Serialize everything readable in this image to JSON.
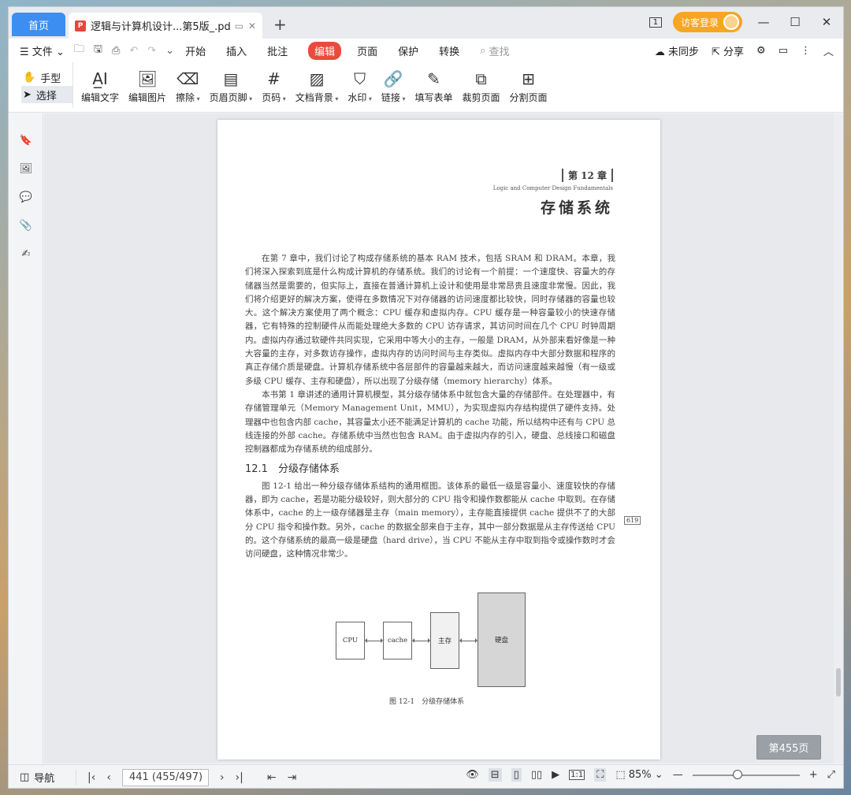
{
  "tabs": {
    "home": "首页",
    "doc_title": "逻辑与计算机设计...第5版_.pdf",
    "pdf_badge": "P"
  },
  "account": {
    "login": "访客登录",
    "page_badge": "1"
  },
  "menu": {
    "file": "文件",
    "items": [
      "开始",
      "插入",
      "批注",
      "编辑",
      "页面",
      "保护",
      "转换"
    ],
    "active": "编辑",
    "search": "查找",
    "sync": "未同步",
    "share": "分享"
  },
  "mode": {
    "hand": "手型",
    "select": "选择"
  },
  "tools": [
    {
      "label": "编辑文字",
      "icon": "text-edit-icon",
      "glyph": "A̲I"
    },
    {
      "label": "编辑图片",
      "icon": "image-edit-icon",
      "glyph": "🖼"
    },
    {
      "label": "擦除",
      "icon": "eraser-icon",
      "glyph": "⌫",
      "dropdown": true
    },
    {
      "label": "页眉页脚",
      "icon": "header-footer-icon",
      "glyph": "▤",
      "dropdown": true
    },
    {
      "label": "页码",
      "icon": "page-number-icon",
      "glyph": "#",
      "dropdown": true
    },
    {
      "label": "文档背景",
      "icon": "background-icon",
      "glyph": "▨",
      "dropdown": true
    },
    {
      "label": "水印",
      "icon": "watermark-icon",
      "glyph": "⛉",
      "dropdown": true
    },
    {
      "label": "链接",
      "icon": "link-icon",
      "glyph": "🔗",
      "dropdown": true
    },
    {
      "label": "填写表单",
      "icon": "form-icon",
      "glyph": "✎"
    },
    {
      "label": "裁剪页面",
      "icon": "crop-page-icon",
      "glyph": "⧉"
    },
    {
      "label": "分割页面",
      "icon": "split-page-icon",
      "glyph": "⊞"
    }
  ],
  "document": {
    "chapter_num": "第 12 章",
    "chapter_en": "Logic and Computer Design Fundamentals",
    "chapter_title": "存储系统",
    "para1": "在第 7 章中，我们讨论了构成存储系统的基本 RAM 技术，包括 SRAM 和 DRAM。本章，我们将深入探索到底是什么构成计算机的存储系统。我们的讨论有一个前提：一个速度快、容量大的存储器当然是需要的，但实际上，直接在普通计算机上设计和使用是非常昂贵且速度非常慢。因此，我们将介绍更好的解决方案，使得在多数情况下对存储器的访问速度都比较快，同时存储器的容量也较大。这个解决方案使用了两个概念：CPU 缓存和虚拟内存。CPU 缓存是一种容量较小的快速存储器，它有特殊的控制硬件从而能处理绝大多数的 CPU 访存请求，其访问时间在几个 CPU 时钟周期内。虚拟内存通过软硬件共同实现，它采用中等大小的主存，一般是 DRAM，从外部来看好像是一种大容量的主存，对多数访存操作，虚拟内存的访问时间与主存类似。虚拟内存中大部分数据和程序的真正存储介质是硬盘。计算机存储系统中各层部件的容量越来越大，而访问速度越来越慢（有一级或多级 CPU 缓存、主存和硬盘），所以出现了分级存储（memory hierarchy）体系。",
    "para2": "本书第 1 章讲述的通用计算机模型，其分级存储体系中就包含大量的存储部件。在处理器中，有存储管理单元（Memory Management Unit，MMU），为实现虚拟内存结构提供了硬件支持。处理器中也包含内部 cache，其容量太小还不能满足计算机的 cache 功能，所以结构中还有与 CPU 总线连接的外部 cache。存储系统中当然也包含 RAM。由于虚拟内存的引入，硬盘、总线接口和磁盘控制器都成为存储系统的组成部分。",
    "section": "12.1　分级存储体系",
    "para3": "图 12-1 给出一种分级存储体系结构的通用框图。该体系的最低一级是容量小、速度较快的存储器，即为 cache，若是功能分级较好，则大部分的 CPU 指令和操作数都能从 cache 中取到。在存储体系中，cache 的上一级存储器是主存（main memory），主存能直接提供 cache 提供不了的大部分 CPU 指令和操作数。另外，cache 的数据全部来自于主存，其中一部分数据是从主存传送给 CPU 的。这个存储系统的最高一级是硬盘（hard drive），当 CPU 不能从主存中取到指令或操作数时才会访问硬盘，这种情况非常少。",
    "page_ref": "619",
    "diagram": {
      "cpu": "CPU",
      "cache": "cache",
      "main": "主存",
      "disk": "硬盘"
    },
    "caption": "图 12-1　分级存储体系"
  },
  "floating_page": "第455页",
  "status": {
    "nav": "导航",
    "page_value": "441 (455/497)",
    "zoom": "85%",
    "zoom_fraction": 0.42
  }
}
